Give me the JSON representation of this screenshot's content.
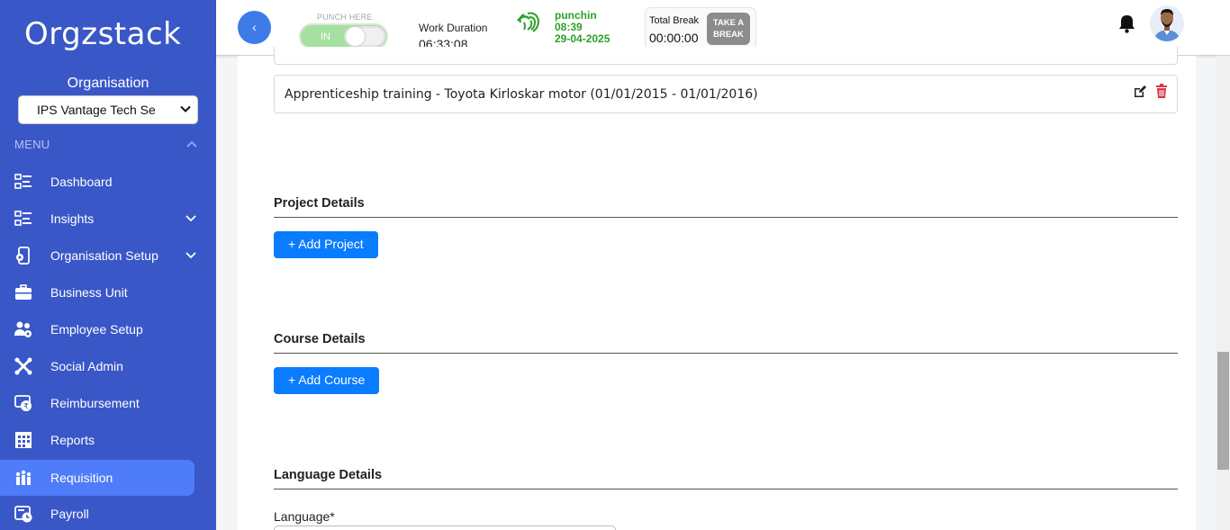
{
  "sidebar": {
    "logo": "Orgzstack",
    "org_label": "Organisation",
    "org_select_value": "IPS Vantage Tech Se",
    "menu_heading": "MENU",
    "items": [
      {
        "label": "Dashboard",
        "icon": "dashboard-icon",
        "has_chevron": false,
        "active": false
      },
      {
        "label": "Insights",
        "icon": "insights-icon",
        "has_chevron": true,
        "active": false
      },
      {
        "label": "Organisation Setup",
        "icon": "organisation-setup-icon",
        "has_chevron": true,
        "active": false
      },
      {
        "label": "Business Unit",
        "icon": "briefcase-icon",
        "has_chevron": false,
        "active": false
      },
      {
        "label": "Employee Setup",
        "icon": "employee-setup-icon",
        "has_chevron": false,
        "active": false
      },
      {
        "label": "Social Admin",
        "icon": "social-admin-icon",
        "has_chevron": false,
        "active": false
      },
      {
        "label": "Reimbursement",
        "icon": "reimbursement-icon",
        "has_chevron": false,
        "active": false
      },
      {
        "label": "Reports",
        "icon": "reports-icon",
        "has_chevron": false,
        "active": false
      },
      {
        "label": "Requisition",
        "icon": "requisition-icon",
        "has_chevron": false,
        "active": true
      },
      {
        "label": "Payroll",
        "icon": "payroll-icon",
        "has_chevron": false,
        "active": false
      }
    ]
  },
  "header": {
    "back_label": "‹",
    "punch_label": "PUNCH HERE",
    "punch_state": "IN",
    "work_duration_label": "Work Duration",
    "work_duration_value": "06:33:08",
    "punch_status": "punchin",
    "punch_time": "08:39",
    "punch_date": "29-04-2025",
    "total_break_label": "Total Break",
    "total_break_value": "00:00:00",
    "take_break_label_1": "TAKE A",
    "take_break_label_2": "BREAK"
  },
  "main": {
    "education_item": "Apprenticeship training - Toyota Kirloskar motor (01/01/2015 - 01/01/2016)",
    "project_title": "Project Details",
    "add_project_label": "+ Add Project",
    "course_title": "Course Details",
    "add_course_label": "+ Add Course",
    "language_title": "Language Details",
    "language_field_label": "Language*"
  },
  "colors": {
    "sidebar_bg": "#3a57c8",
    "active_item": "#4f7cf8",
    "primary_button": "#0a7cff",
    "punch_green": "#2ca02c",
    "delete_red": "#d9363e"
  }
}
